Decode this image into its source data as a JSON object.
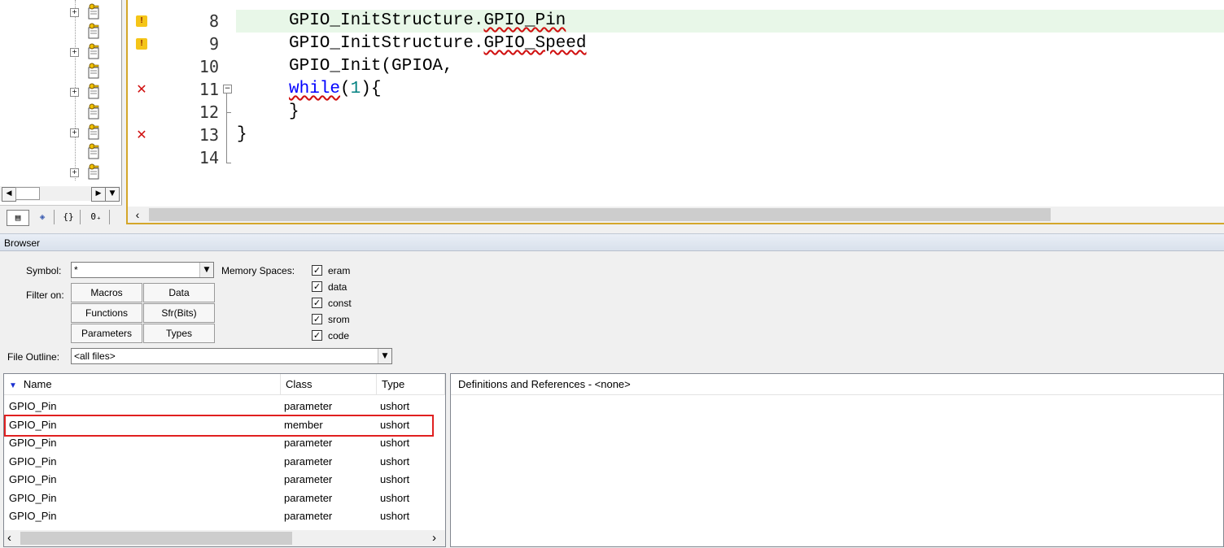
{
  "editor": {
    "lines": [
      {
        "num": "8",
        "marker": "warning",
        "text_a": "GPIO_InitStructure.",
        "text_b": "GPIO_Pin",
        "highlight": true
      },
      {
        "num": "9",
        "marker": "warning",
        "text_a": "GPIO_InitStructure.",
        "text_b": "GPIO_Speed",
        "highlight": false
      },
      {
        "num": "10",
        "marker": "",
        "text_a": "GPIO_Init(GPIOA,",
        "text_b": "",
        "highlight": false
      },
      {
        "num": "11",
        "marker": "error",
        "kw": "while",
        "paren_open": "(",
        "num_lit": "1",
        "paren_close": "){",
        "highlight": false
      },
      {
        "num": "12",
        "marker": "",
        "text_a": "}",
        "text_b": "",
        "highlight": false
      },
      {
        "num": "13",
        "marker": "error",
        "text_a": "}",
        "text_b": "",
        "highlight": false
      },
      {
        "num": "14",
        "marker": "",
        "text_a": "",
        "text_b": "",
        "highlight": false
      }
    ],
    "marker_glyphs": {
      "warning": "!",
      "error": "✕"
    },
    "hscroll_left": "‹"
  },
  "tree": {
    "expand_glyph": "+",
    "scroll_left": "◀",
    "scroll_right": "▶",
    "scroll_down": "▼",
    "tabs": [
      "▤",
      "◈",
      "{}",
      "0₊"
    ]
  },
  "browser": {
    "title": "Browser",
    "symbol_label": "Symbol:",
    "symbol_value": "*",
    "memory_label": "Memory Spaces:",
    "filter_label": "Filter on:",
    "filters": [
      "Macros",
      "Data",
      "Functions",
      "Sfr(Bits)",
      "Parameters",
      "Types"
    ],
    "memory_spaces": [
      "eram",
      "data",
      "const",
      "srom",
      "code"
    ],
    "check_glyph": "✓",
    "outline_label": "File Outline:",
    "outline_value": "<all files>",
    "dropdown_glyph": "▼",
    "table": {
      "sort_glyph": "▼",
      "headers": {
        "name": "Name",
        "class": "Class",
        "type": "Type"
      },
      "rows": [
        {
          "name": "GPIO_Pin",
          "class": "parameter",
          "type": "ushort"
        },
        {
          "name": "GPIO_Pin",
          "class": "member",
          "type": "ushort"
        },
        {
          "name": "GPIO_Pin",
          "class": "parameter",
          "type": "ushort"
        },
        {
          "name": "GPIO_Pin",
          "class": "parameter",
          "type": "ushort"
        },
        {
          "name": "GPIO_Pin",
          "class": "parameter",
          "type": "ushort"
        },
        {
          "name": "GPIO_Pin",
          "class": "parameter",
          "type": "ushort"
        },
        {
          "name": "GPIO_Pin",
          "class": "parameter",
          "type": "ushort"
        }
      ],
      "scroll_left": "‹",
      "scroll_right": "›"
    },
    "defs_header": "Definitions and References - <none>"
  },
  "colors": {
    "accent": "#d4a62a",
    "selection": "#e02020",
    "keyword": "#0000ff",
    "number": "#008080"
  }
}
